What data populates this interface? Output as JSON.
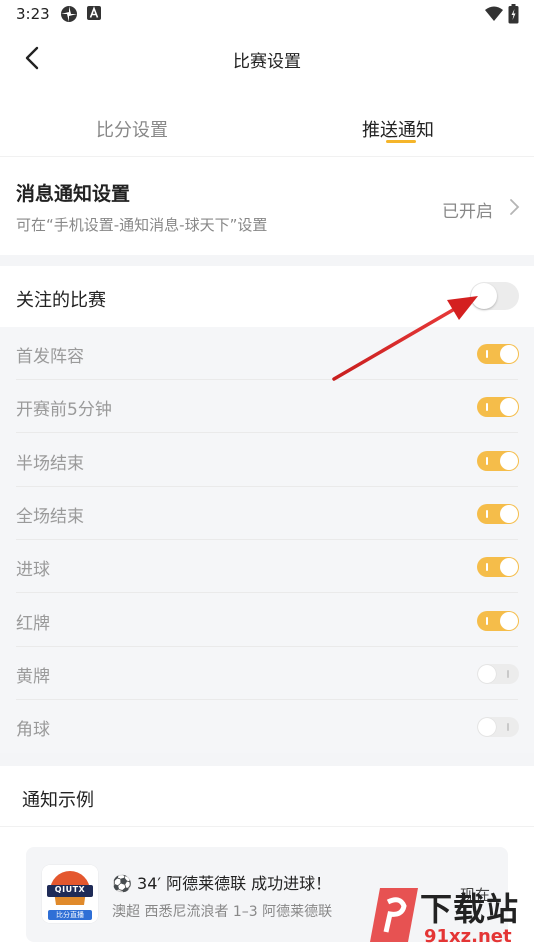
{
  "status_bar": {
    "time": "3:23"
  },
  "header": {
    "title": "比赛设置"
  },
  "tabs": [
    {
      "label": "比分设置",
      "active": false
    },
    {
      "label": "推送通知",
      "active": true
    }
  ],
  "message_settings": {
    "title": "消息通知设置",
    "subtitle": "可在“手机设置-通知消息-球天下”设置",
    "status": "已开启"
  },
  "follow": {
    "label": "关注的比赛",
    "enabled": false
  },
  "sub_items": [
    {
      "label": "首发阵容",
      "on": true
    },
    {
      "label": "开赛前5分钟",
      "on": true
    },
    {
      "label": "半场结束",
      "on": true
    },
    {
      "label": "全场结束",
      "on": true
    },
    {
      "label": "进球",
      "on": true
    },
    {
      "label": "红牌",
      "on": true
    },
    {
      "label": "黄牌",
      "on": false
    },
    {
      "label": "角球",
      "on": false
    }
  ],
  "example": {
    "label": "通知示例",
    "notification": {
      "logo_text": "QIUTX",
      "logo_subtext": "比分直播",
      "title": "⚽ 34′ 阿德莱德联 成功进球！",
      "body": "澳超 西悉尼流浪者 1–3 阿德莱德联",
      "time": "现在"
    }
  },
  "watermark": {
    "text": "下载站",
    "domain": "91xz.net"
  },
  "colors": {
    "accent": "#F5B52A",
    "toggle_on": "#F5BD4A",
    "arrow": "#D42020"
  }
}
